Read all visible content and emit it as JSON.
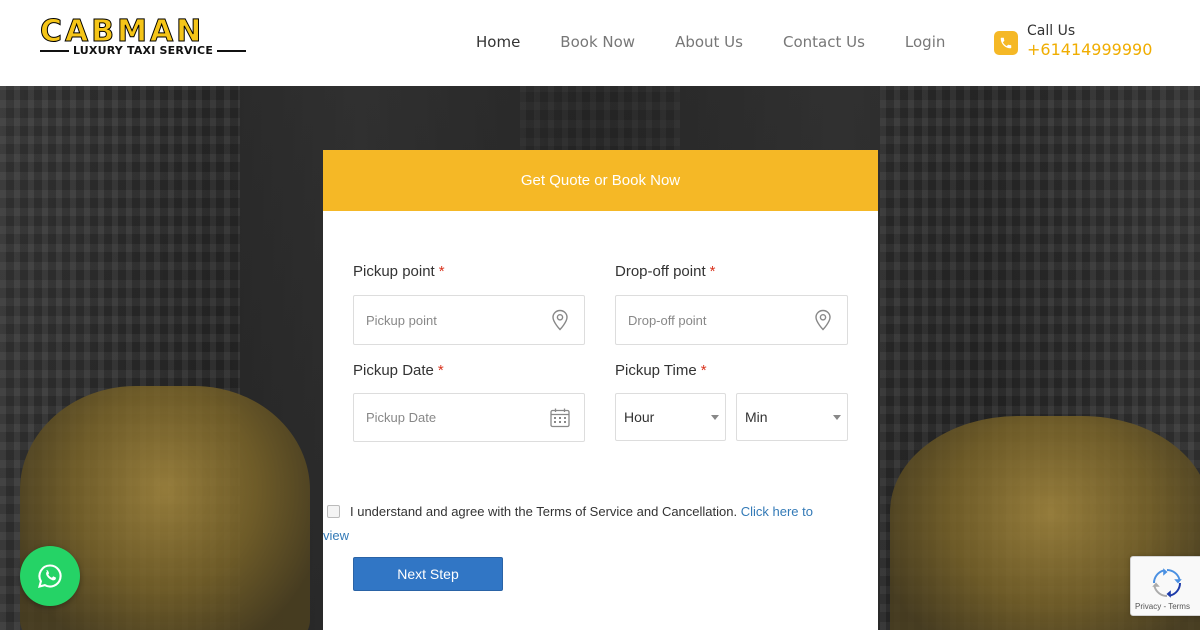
{
  "brand": {
    "name": "CABMAN",
    "tagline": "LUXURY TAXI SERVICE"
  },
  "nav": [
    {
      "label": "Home",
      "active": true
    },
    {
      "label": "Book Now"
    },
    {
      "label": "About Us"
    },
    {
      "label": "Contact Us"
    },
    {
      "label": "Login"
    }
  ],
  "call": {
    "label": "Call Us",
    "number": "+61414999990",
    "icon": "phone-icon"
  },
  "form": {
    "title": "Get Quote or Book Now",
    "pickup_point": {
      "label": "Pickup point",
      "required": "*",
      "placeholder": "Pickup point",
      "icon": "map-pin-icon"
    },
    "dropoff_point": {
      "label": "Drop-off point",
      "required": "*",
      "placeholder": "Drop-off point",
      "icon": "map-pin-icon"
    },
    "pickup_date": {
      "label": "Pickup Date",
      "required": "*",
      "placeholder": "Pickup Date",
      "icon": "calendar-icon"
    },
    "pickup_time": {
      "label": "Pickup Time",
      "required": "*",
      "hour": "Hour",
      "min": "Min"
    },
    "agree_text": "I understand and agree with the Terms of Service and Cancellation.",
    "agree_link": "Click here to view",
    "next_label": "Next Step"
  },
  "colors": {
    "accent": "#f5b826",
    "button": "#3176c5",
    "whatsapp": "#25d366",
    "link": "#337ab7"
  },
  "whatsapp": {
    "icon": "whatsapp-icon"
  },
  "recaptcha": {
    "text": "Privacy - Terms"
  }
}
